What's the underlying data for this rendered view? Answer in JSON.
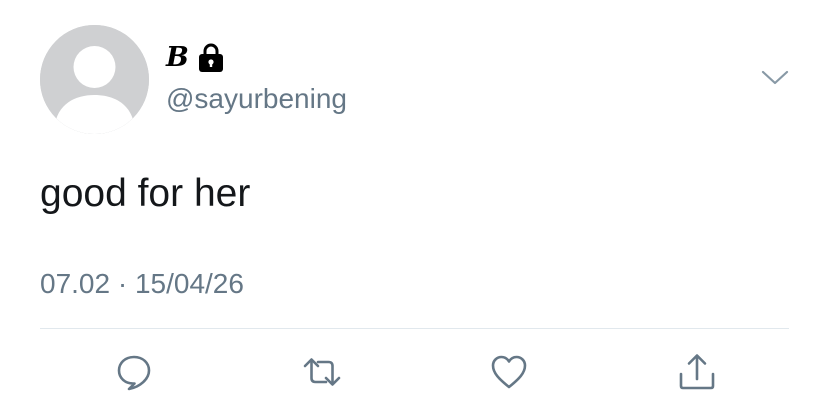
{
  "tweet": {
    "display_name": "B",
    "handle": "@sayurbening",
    "text": "good for her",
    "timestamp": "07.02 · 15/04/26",
    "protected": true
  },
  "icons": {
    "avatar": "default-avatar-icon",
    "lock": "lock-icon",
    "menu": "chevron-down-icon",
    "reply": "reply-icon",
    "retweet": "retweet-icon",
    "like": "heart-icon",
    "share": "share-icon"
  },
  "colors": {
    "text_primary": "#14171a",
    "text_secondary": "#657786",
    "divider": "#e1e8ed",
    "avatar_bg": "#cfd0d2",
    "icon_gray": "#657786"
  }
}
